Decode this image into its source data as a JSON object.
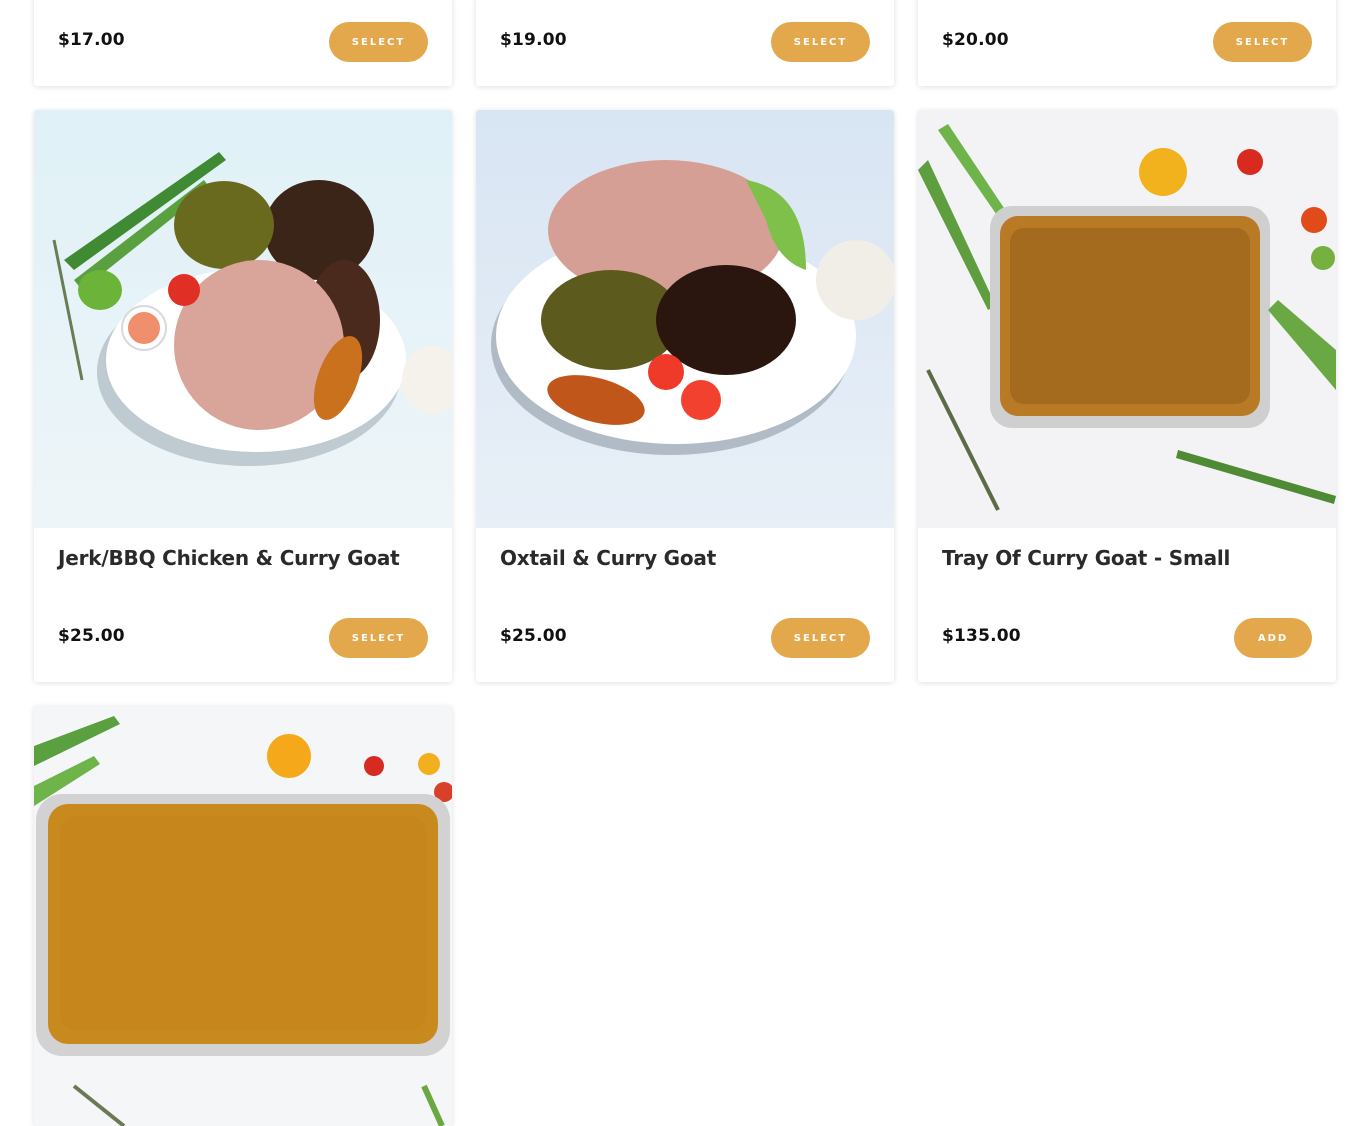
{
  "top_row": [
    {
      "price": "$17.00",
      "button": "SELECT"
    },
    {
      "price": "$19.00",
      "button": "SELECT"
    },
    {
      "price": "$20.00",
      "button": "SELECT"
    }
  ],
  "middle_row": [
    {
      "name": "Jerk/BBQ Chicken & Curry Goat",
      "price": "$25.00",
      "button": "SELECT",
      "image": "jerk-chicken-curry-goat-plate"
    },
    {
      "name": "Oxtail & Curry Goat",
      "price": "$25.00",
      "button": "SELECT",
      "image": "oxtail-curry-goat-plate"
    },
    {
      "name": "Tray Of Curry Goat - Small",
      "price": "$135.00",
      "button": "ADD",
      "image": "curry-goat-tray-small"
    }
  ],
  "bottom_row": [
    {
      "image": "curry-goat-tray-large"
    }
  ],
  "colors": {
    "button_bg": "#e4a84c",
    "button_text": "#ffffff",
    "price_text": "#111111",
    "title_text": "#2a2a2a"
  }
}
